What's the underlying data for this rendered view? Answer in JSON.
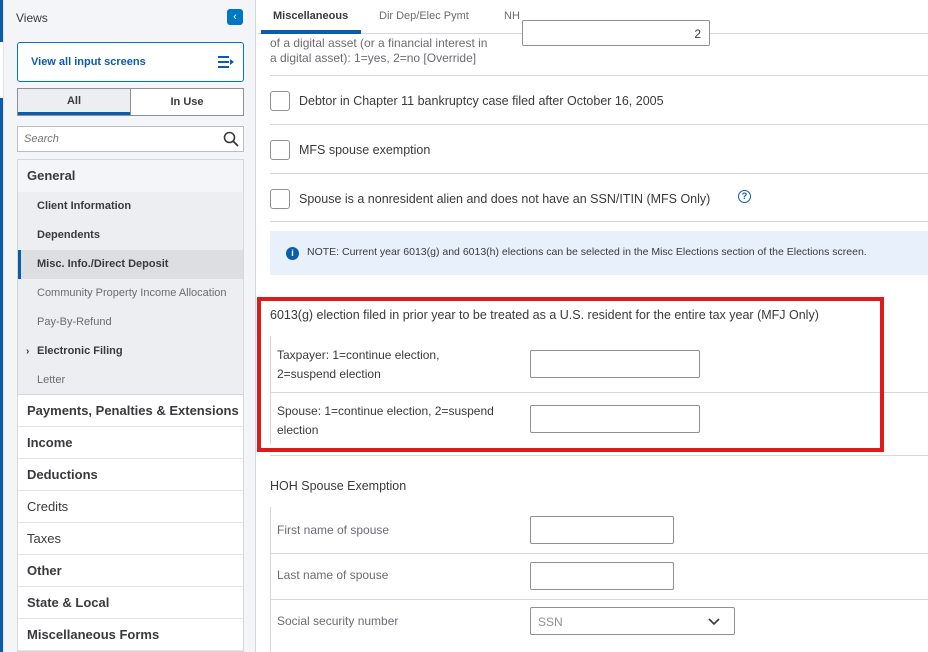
{
  "sidebar": {
    "title": "Views",
    "collapse_icon": "chevron-left-icon",
    "view_all_label": "View all input screens",
    "view_all_icon": "list-menu-icon",
    "segment": {
      "all": "All",
      "in_use": "In Use"
    },
    "search_placeholder": "Search",
    "groups": [
      {
        "label": "General"
      },
      {
        "label": "Payments, Penalties & Extensions"
      },
      {
        "label": "Income"
      },
      {
        "label": "Deductions"
      },
      {
        "label": "Credits"
      },
      {
        "label": "Taxes"
      },
      {
        "label": "Other"
      },
      {
        "label": "State & Local"
      },
      {
        "label": "Miscellaneous Forms"
      }
    ],
    "general_items": [
      {
        "label": "Client Information"
      },
      {
        "label": "Dependents"
      },
      {
        "label": "Misc. Info./Direct Deposit"
      },
      {
        "label": "Community Property Income Allocation"
      },
      {
        "label": "Pay-By-Refund"
      },
      {
        "label": "Electronic Filing"
      },
      {
        "label": "Letter"
      }
    ]
  },
  "tabs": [
    {
      "label": "Miscellaneous"
    },
    {
      "label": "Dir Dep/Elec Pymt"
    },
    {
      "label": "NH"
    }
  ],
  "main": {
    "digital_asset_line1": "of a digital asset (or a financial interest in",
    "digital_asset_line2": "a digital asset): 1=yes, 2=no [Override]",
    "digital_asset_value": "2",
    "checkbox_debtor": "Debtor in Chapter 11 bankruptcy case filed after October 16, 2005",
    "checkbox_mfs": "MFS spouse exemption",
    "checkbox_nonresident": "Spouse is a nonresident alien and does not have an SSN/ITIN (MFS Only)",
    "help_glyph": "?",
    "note_glyph": "i",
    "note_text": "NOTE: Current year 6013(g) and 6013(h) elections can be selected in the Misc Elections section of the Elections screen.",
    "election_heading": "6013(g) election filed in prior year to be treated as a U.S. resident for the entire tax year (MFJ Only)",
    "taxpayer_line1": "Taxpayer: 1=continue election,",
    "taxpayer_line2": "2=suspend election",
    "spouse_line1": "Spouse: 1=continue election, 2=suspend",
    "spouse_line2": "election",
    "hoh_heading": "HOH Spouse Exemption",
    "first_name_label": "First name of spouse",
    "last_name_label": "Last name of spouse",
    "ssn_label": "Social security number",
    "ssn_placeholder": "SSN"
  },
  "colors": {
    "accent": "#0b5cab",
    "highlight": "#e01a1a"
  }
}
